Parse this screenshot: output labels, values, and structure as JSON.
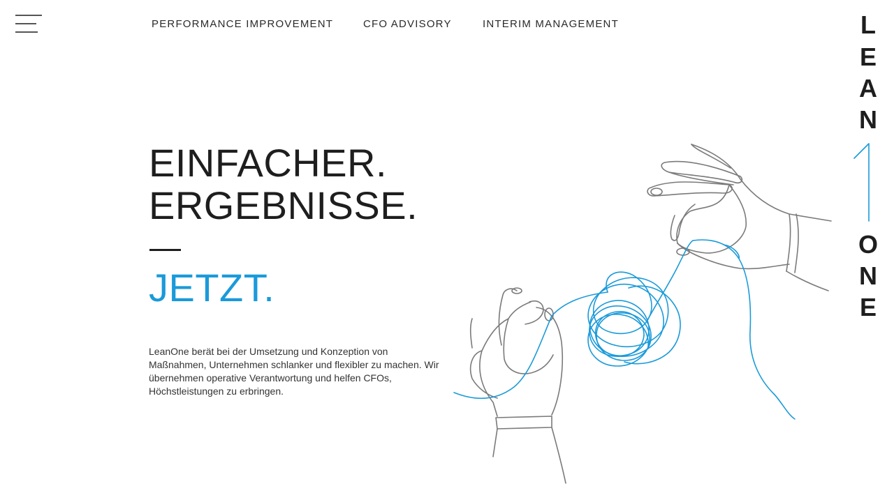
{
  "nav": {
    "menu_icon": "hamburger-menu-icon",
    "items": [
      {
        "label": "PERFORMANCE IMPROVEMENT"
      },
      {
        "label": "CFO ADVISORY"
      },
      {
        "label": "INTERIM MANAGEMENT"
      }
    ]
  },
  "hero": {
    "line1": "EINFACHER.",
    "line2": "ERGEBNISSE.",
    "accent": "JETZT.",
    "accent_color": "#1a9ad9",
    "text_color": "#1e1e1e"
  },
  "intro": {
    "text": "LeanOne berät bei der Umsetzung und Konzeption von Maßnahmen, Unternehmen schlanker und flexibler zu machen. Wir übernehmen operative Verantwortung und helfen CFOs, Höchstleistungen zu erbringen."
  },
  "illustration": {
    "icon": "hands-untangling-thread-illustration"
  },
  "brand": {
    "letters_top": [
      "L",
      "E",
      "A",
      "N"
    ],
    "letters_bottom": [
      "O",
      "N",
      "E"
    ],
    "mark_icon": "brand-one-stroke-icon",
    "mark_color": "#1a9ad9"
  }
}
